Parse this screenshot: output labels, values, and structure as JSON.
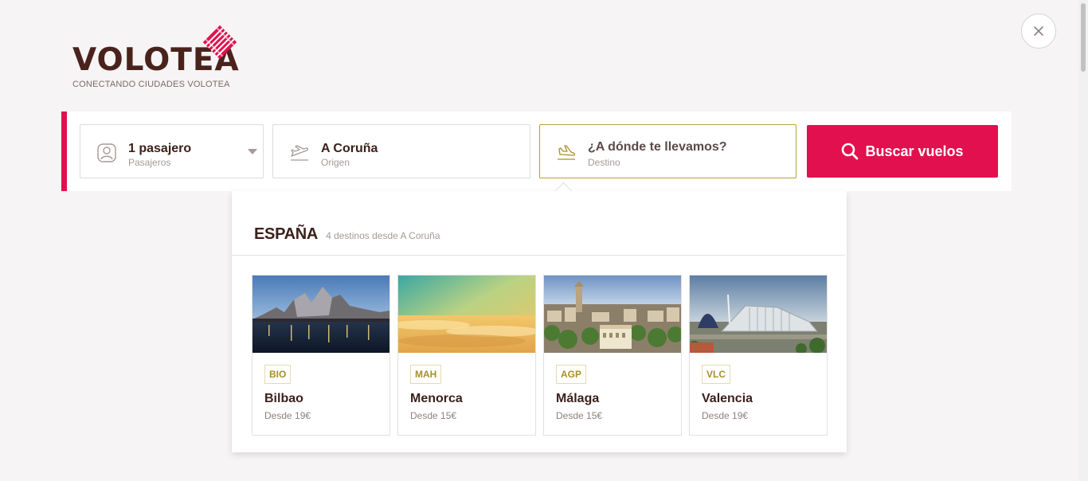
{
  "brand": {
    "name": "VOLOTEA",
    "tagline": "CONECTANDO CIUDADES VOLOTEA",
    "accent_color": "#e2104e",
    "text_color": "#3b1f1a"
  },
  "close_icon": "close-icon",
  "search": {
    "passengers": {
      "value": "1 pasajero",
      "label": "Pasajeros",
      "icon": "person-icon"
    },
    "origin": {
      "value": "A Coruña",
      "label": "Origen",
      "icon": "takeoff-icon"
    },
    "destination": {
      "placeholder": "¿A dónde te llevamos?",
      "value": "",
      "label": "Destino",
      "icon": "landing-icon"
    },
    "button_label": "Buscar vuelos",
    "button_icon": "search-icon"
  },
  "dropdown": {
    "country": "ESPAÑA",
    "count_text": "4 destinos desde A Coruña",
    "destinations": [
      {
        "code": "BIO",
        "city": "Bilbao",
        "price": "Desde 19€"
      },
      {
        "code": "MAH",
        "city": "Menorca",
        "price": "Desde 15€"
      },
      {
        "code": "AGP",
        "city": "Málaga",
        "price": "Desde 15€"
      },
      {
        "code": "VLC",
        "city": "Valencia",
        "price": "Desde 19€"
      }
    ]
  }
}
